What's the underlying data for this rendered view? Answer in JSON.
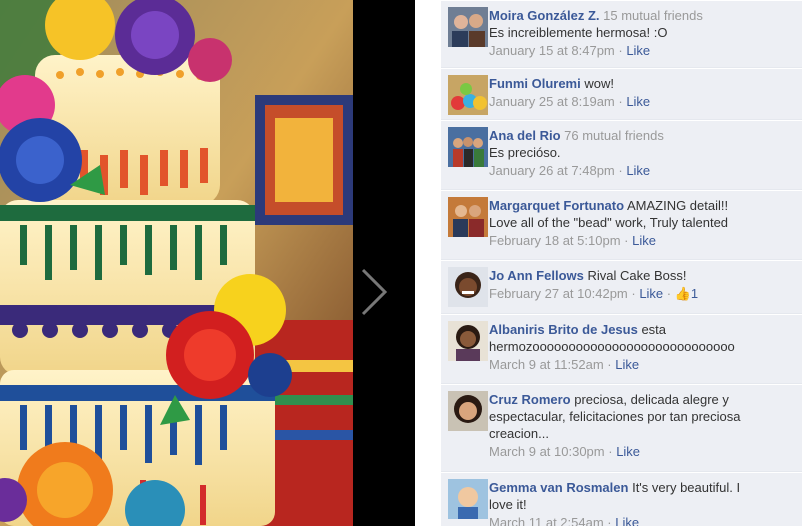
{
  "comments": [
    {
      "author": "Moira González Z.",
      "mutual": "15 mutual friends",
      "text": "Es increiblemente hermosa! :O",
      "date": "January 15 at 8:47pm",
      "like": "Like",
      "avatar_icon": "profile-photo-couple"
    },
    {
      "author": "Funmi Oluremi",
      "mutual": "",
      "text": "wow!",
      "date": "January 25 at 8:19am",
      "like": "Like",
      "avatar_icon": "profile-photo-colorful"
    },
    {
      "author": "Ana del Rio",
      "mutual": "76 mutual friends",
      "text": "Es precióso.",
      "date": "January 26 at 7:48pm",
      "like": "Like",
      "avatar_icon": "profile-photo-group"
    },
    {
      "author": "Margarquet Fortunato",
      "mutual": "",
      "text_inline": "AMAZING detail!!",
      "text": "Love all of the \"bead\" work, Truly talented",
      "date": "February 18 at 5:10pm",
      "like": "Like",
      "avatar_icon": "profile-photo-two-people"
    },
    {
      "author": "Jo Ann Fellows",
      "mutual": "",
      "text_inline": "Rival Cake Boss!",
      "date": "February 27 at 10:42pm",
      "like": "Like",
      "like_count": "1",
      "avatar_icon": "profile-photo-woman-smiling"
    },
    {
      "author": "Albaniris Brito de Jesus",
      "mutual": "",
      "text_inline": "esta",
      "text": "hermozoooooooooooooooooooooooooooo",
      "date": "March 9 at 11:52am",
      "like": "Like",
      "avatar_icon": "profile-photo-woman"
    },
    {
      "author": "Cruz Romero",
      "mutual": "",
      "text_inline": "preciosa, delicada alegre y",
      "text": "espectacular, felicitaciones por tan preciosa creacion...",
      "date": "March 9 at 10:30pm",
      "like": "Like",
      "avatar_icon": "profile-photo-woman-dark-hair"
    },
    {
      "author": "Gemma van Rosmalen",
      "mutual": "",
      "text_inline": "It's very beautiful. I",
      "text": "love it!",
      "date": "March 11 at 2:54am",
      "like": "Like",
      "avatar_icon": "profile-photo-child"
    }
  ],
  "colors": {
    "link": "#3b5998",
    "panel_bg": "#edeff4",
    "meta": "#999999"
  },
  "next_icon": "chevron-right-icon"
}
